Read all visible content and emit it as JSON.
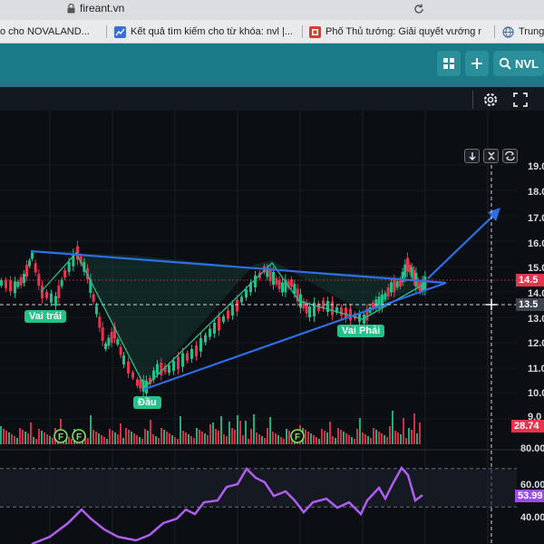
{
  "browser": {
    "url": "fireant.vn",
    "tabs": [
      {
        "label": "o cho NOVALAND..."
      },
      {
        "label": "Kết quả tìm kiếm cho từ khóa: nvl |..."
      },
      {
        "label": "Phố Thủ tướng: Giải quyết vướng m..."
      },
      {
        "label": "Trung t"
      }
    ]
  },
  "toolbar": {
    "symbol": "NVL"
  },
  "chart": {
    "annotations": {
      "left_shoulder": "Vai trái",
      "head": "Đầu",
      "right_shoulder": "Vai Phải"
    },
    "price_axis": [
      "19.0",
      "18.0",
      "17.0",
      "16.0",
      "15.0",
      "14.0",
      "13.0",
      "12.0",
      "11.0",
      "10.0",
      "9.0"
    ],
    "current_price": "14.5",
    "crosshair_price": "13.5",
    "volume_value": "28.74",
    "rsi_axis": [
      "80.00",
      "60.00",
      "40.00"
    ],
    "rsi_value": "53.99",
    "colors": {
      "up": "#22c08a",
      "down": "#e8344d",
      "trend": "#2f6fe6",
      "rsi": "#b05df0"
    }
  }
}
